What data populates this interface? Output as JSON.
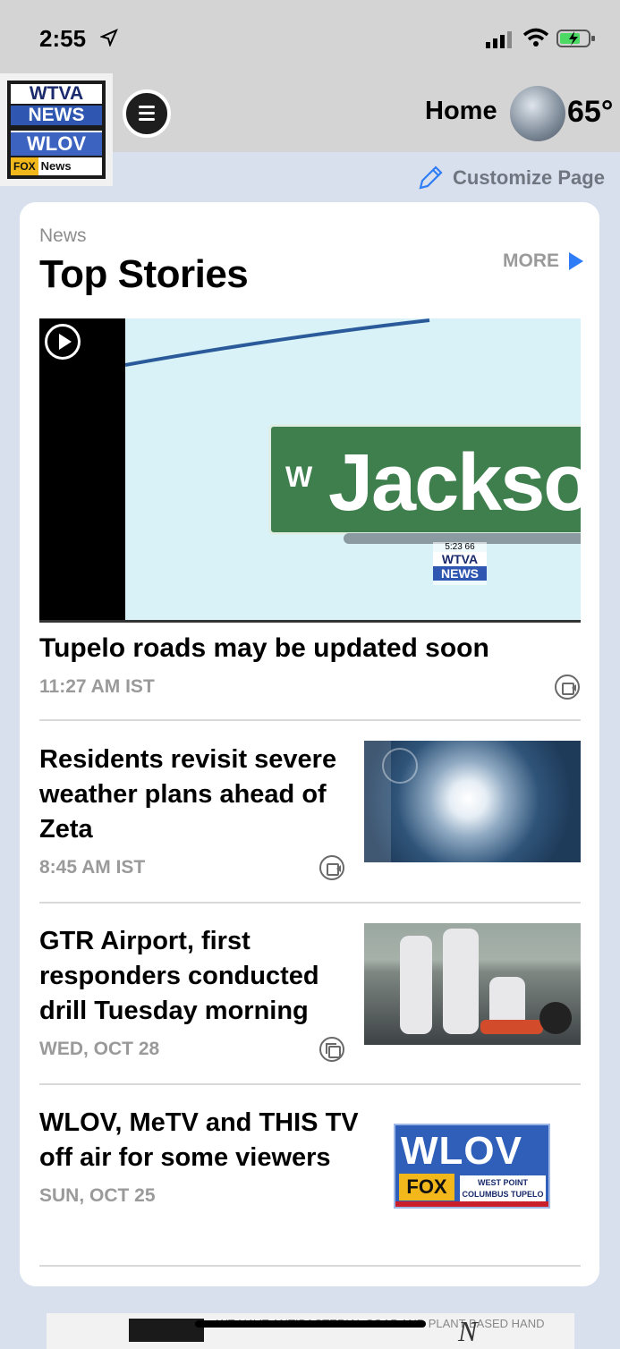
{
  "status": {
    "time": "2:55"
  },
  "logo": {
    "line1": "WTVA",
    "line2": "NEWS",
    "line3": "WLOV",
    "fox": "FOX",
    "news": "News"
  },
  "header": {
    "home": "Home",
    "temperature": "65°"
  },
  "customize": {
    "label": "Customize Page"
  },
  "section": {
    "label": "News",
    "title": "Top Stories",
    "more": "MORE"
  },
  "hero": {
    "sign_prefix": "W",
    "sign_text": "Jackson",
    "bug_small": "5:23 66",
    "bug_a": "WTVA",
    "bug_b": "NEWS",
    "title": "Tupelo roads may be updated soon",
    "time": "11:27 AM IST"
  },
  "stories": [
    {
      "title": "Residents revisit severe weather plans ahead of Zeta",
      "time": "8:45 AM IST",
      "media": "video-icon"
    },
    {
      "title": "GTR Airport, first responders conducted drill Tuesday morning",
      "time": "WED, OCT 28",
      "media": "gallery-icon"
    },
    {
      "title": "WLOV, MeTV and THIS TV off air for some viewers",
      "time": "SUN, OCT 25"
    }
  ],
  "wlov_logo": {
    "text": "WLOV",
    "fox": "FOX",
    "cities": "WEST POINT COLUMBUS TUPELO"
  },
  "ad": {
    "text": "WE HAVE ANTIBACTERIAL SOAP AND PLANT BASED HAND"
  },
  "colors": {
    "accent": "#2f7df6",
    "header_bg": "#d4d4d4",
    "page_bg": "#d8e0ee"
  }
}
